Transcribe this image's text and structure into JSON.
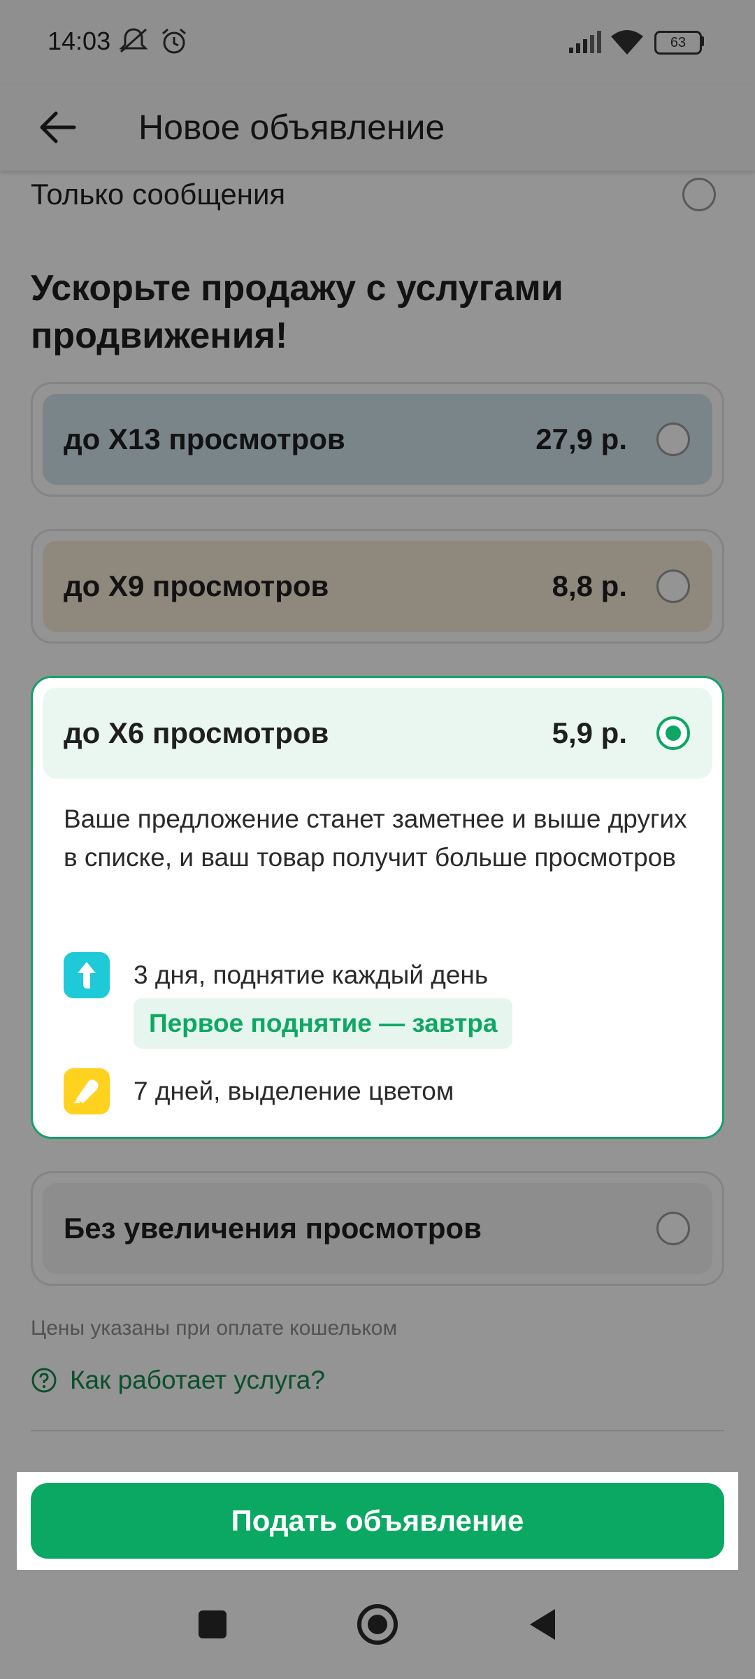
{
  "status_bar": {
    "time": "14:03",
    "battery": "63"
  },
  "app_bar": {
    "title": "Новое объявление"
  },
  "contact": {
    "messages_only_label": "Только сообщения"
  },
  "promo": {
    "heading": "Ускорьте продажу с услугами продвижения!",
    "options": [
      {
        "title": "до X13 просмотров",
        "price": "27,9 р.",
        "bg": "#d3e5ee",
        "selected": false
      },
      {
        "title": "до X9 просмотров",
        "price": "8,8 р.",
        "bg": "#f4ecd6",
        "selected": false
      },
      {
        "title": "до X6 просмотров",
        "price": "5,9 р.",
        "bg": "#eaf7f0",
        "selected": true,
        "description": "Ваше предложение станет заметнее и выше других в списке, и ваш товар получит больше просмотров",
        "features": [
          {
            "icon": "arrow-up-icon",
            "text": "3 дня, поднятие каждый день",
            "chip": "Первое поднятие — завтра",
            "color": "#1ec9d8"
          },
          {
            "icon": "highlighter-icon",
            "text": "7 дней, выделение цветом",
            "color": "#ffd21f"
          }
        ]
      },
      {
        "title": "Без увеличения просмотров",
        "bg": "#f3f3f3",
        "selected": false
      }
    ],
    "price_note": "Цены указаны при оплате кошельком",
    "how_link": "Как работает услуга?"
  },
  "submit_button": "Подать объявление",
  "colors": {
    "accent": "#0aa862",
    "link": "#14894f"
  }
}
